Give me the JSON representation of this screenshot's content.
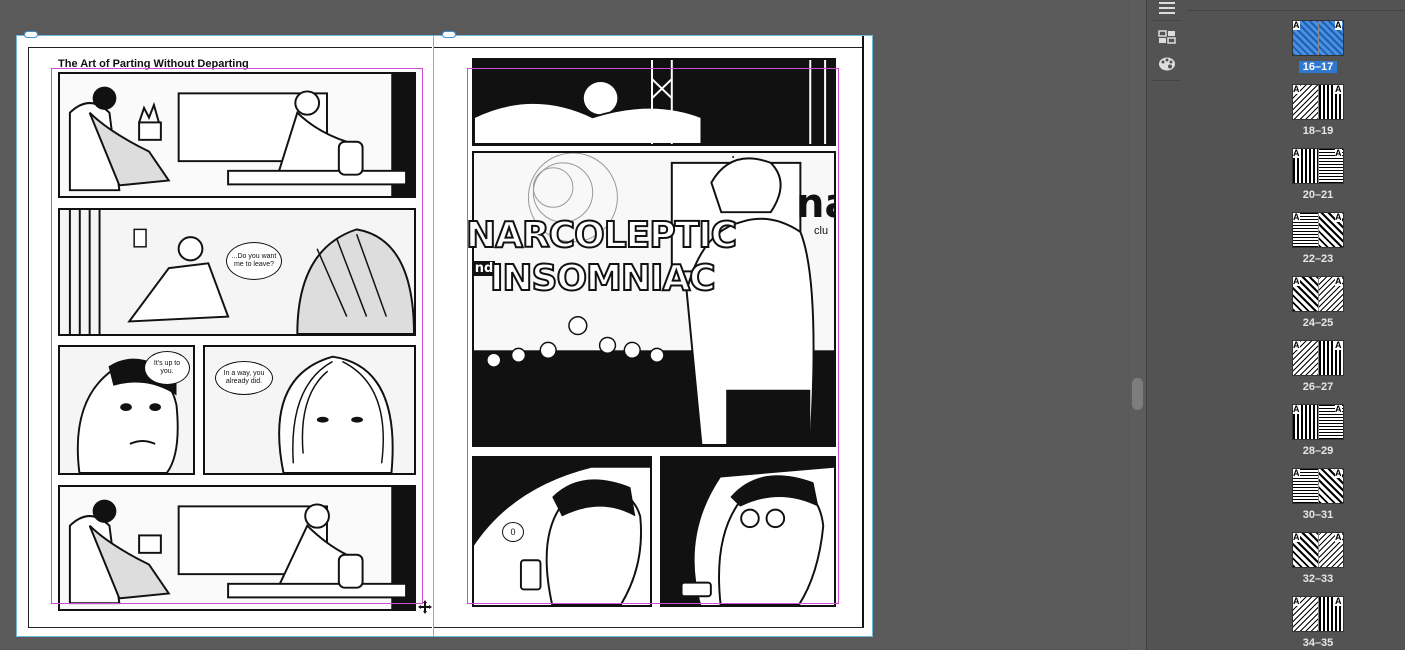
{
  "document": {
    "left_page_title": "The Art of Parting Without Departing",
    "left_page_bubbles": {
      "p2": "...Do you want me to leave?",
      "p3": "It's up to you.",
      "p4": "In a way, you already did."
    },
    "right_page_logo": {
      "word1": "NARCOLEPTIC",
      "and": "and",
      "word2": "INSOMNIAC"
    },
    "right_page_sign": "na",
    "right_page_sign_sub": "clu",
    "right_page_bubble": "0"
  },
  "pages_panel": {
    "master_letter": "A",
    "thumbnails": [
      {
        "label": "16–17",
        "selected": true
      },
      {
        "label": "18–19",
        "selected": false
      },
      {
        "label": "20–21",
        "selected": false
      },
      {
        "label": "22–23",
        "selected": false
      },
      {
        "label": "24–25",
        "selected": false
      },
      {
        "label": "26–27",
        "selected": false
      },
      {
        "label": "28–29",
        "selected": false
      },
      {
        "label": "30–31",
        "selected": false
      },
      {
        "label": "32–33",
        "selected": false
      },
      {
        "label": "34–35",
        "selected": false
      }
    ]
  },
  "tools": [
    "hamburger-menu-icon",
    "pages-grid-icon",
    "color-palette-icon"
  ],
  "colors": {
    "selection": "#2f78d0",
    "margin_guide": "#d14ad8",
    "bleed_frame": "#6fb6d9"
  }
}
